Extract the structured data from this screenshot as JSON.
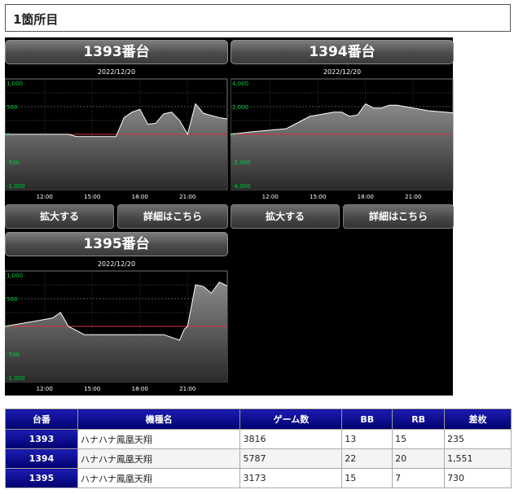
{
  "section": {
    "title": "1箇所目"
  },
  "machines": [
    {
      "title": "1393番台",
      "date": "2022/12/20",
      "zoom_label": "拡大する",
      "detail_label": "詳細はこちら",
      "chart_data": {
        "type": "area",
        "ylim": [
          -1000,
          1000
        ],
        "y_ticks": [
          "1,000",
          "500",
          "0",
          "-500",
          "-1,000"
        ],
        "x_ticks": [
          "12:00",
          "15:00",
          "18:00",
          "21:00"
        ],
        "x_tick_hours": [
          12,
          15,
          18,
          21
        ],
        "xlim": [
          9.5,
          23.5
        ],
        "x": [
          9.5,
          10.5,
          11.5,
          12.5,
          13.5,
          14.0,
          14.5,
          15.5,
          16.5,
          17.0,
          17.5,
          18.0,
          18.5,
          19.0,
          19.5,
          20.0,
          20.5,
          21.0,
          21.5,
          22.0,
          23.0,
          23.5
        ],
        "y": [
          0,
          0,
          0,
          0,
          0,
          -40,
          -40,
          -40,
          -40,
          300,
          400,
          450,
          180,
          200,
          370,
          400,
          250,
          0,
          550,
          380,
          300,
          280
        ]
      }
    },
    {
      "title": "1394番台",
      "date": "2022/12/20",
      "zoom_label": "拡大する",
      "detail_label": "詳細はこちら",
      "chart_data": {
        "type": "area",
        "ylim": [
          -4000,
          4000
        ],
        "y_ticks": [
          "4,000",
          "2,000",
          "0",
          "-2,000",
          "-4,000"
        ],
        "x_ticks": [
          "12:00",
          "15:00",
          "18:00",
          "21:00"
        ],
        "x_tick_hours": [
          12,
          15,
          18,
          21
        ],
        "xlim": [
          9.5,
          23.5
        ],
        "x": [
          9.5,
          11.0,
          12.0,
          13.0,
          14.0,
          14.5,
          15.0,
          15.5,
          16.0,
          16.5,
          17.0,
          17.5,
          18.0,
          18.5,
          19.0,
          19.5,
          20.0,
          21.0,
          22.0,
          23.5
        ],
        "y": [
          0,
          200,
          300,
          400,
          1000,
          1300,
          1400,
          1500,
          1600,
          1600,
          1300,
          1400,
          2200,
          1900,
          1900,
          2100,
          2100,
          1900,
          1700,
          1551
        ]
      }
    },
    {
      "title": "1395番台",
      "date": "2022/12/20",
      "zoom_label": "",
      "detail_label": "",
      "chart_data": {
        "type": "area",
        "ylim": [
          -1000,
          1000
        ],
        "y_ticks": [
          "1,000",
          "500",
          "0",
          "-500",
          "-1,000"
        ],
        "x_ticks": [
          "12:00",
          "15:00",
          "18:00",
          "21:00"
        ],
        "x_tick_hours": [
          12,
          15,
          18,
          21
        ],
        "xlim": [
          9.5,
          23.5
        ],
        "x": [
          9.5,
          10.5,
          11.5,
          12.5,
          13.0,
          13.5,
          14.5,
          15.5,
          16.5,
          17.5,
          18.5,
          19.5,
          20.5,
          20.8,
          21.0,
          21.5,
          22.0,
          22.5,
          23.0,
          23.5
        ],
        "y": [
          0,
          50,
          100,
          150,
          250,
          0,
          -150,
          -150,
          -150,
          -150,
          -150,
          -150,
          -250,
          -50,
          0,
          750,
          720,
          600,
          800,
          730
        ]
      }
    }
  ],
  "table": {
    "headers": [
      "台番",
      "機種名",
      "ゲーム数",
      "BB",
      "RB",
      "差枚"
    ],
    "rows": [
      [
        "1393",
        "ハナハナ鳳凰天翔",
        "3816",
        "13",
        "15",
        "235"
      ],
      [
        "1394",
        "ハナハナ鳳凰天翔",
        "5787",
        "22",
        "20",
        "1,551"
      ],
      [
        "1395",
        "ハナハナ鳳凰天翔",
        "3173",
        "15",
        "7",
        "730"
      ]
    ]
  },
  "colors": {
    "panel_bg": "#000000",
    "chart_fill": "#7a7a7a",
    "chart_line": "#ffffff",
    "zero_line": "#d23a3a",
    "axis_label": "#00cc44",
    "header_blue": "#0a0a9a"
  }
}
